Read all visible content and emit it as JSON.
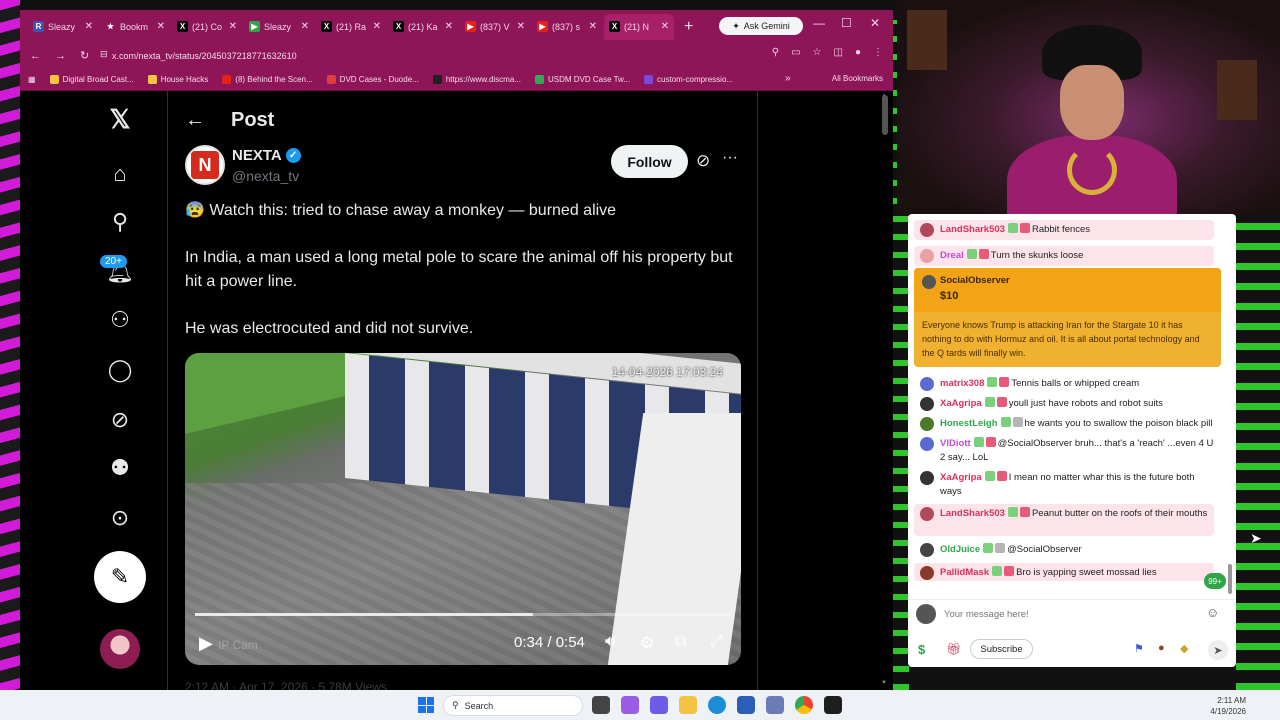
{
  "browser": {
    "tabs": [
      {
        "label": "Sleazy",
        "icon": "R",
        "color": "#3f51b5"
      },
      {
        "label": "Bookm",
        "icon": "★",
        "color": "#8e1558"
      },
      {
        "label": "(21) Co",
        "icon": "X",
        "color": "#000000"
      },
      {
        "label": "Sleazy",
        "icon": "▶",
        "color": "#2fa54a"
      },
      {
        "label": "(21) Ra",
        "icon": "X",
        "color": "#000000"
      },
      {
        "label": "(21) Ka",
        "icon": "X",
        "color": "#000000"
      },
      {
        "label": "(837) V",
        "icon": "▶",
        "color": "#e62117"
      },
      {
        "label": "(837) s",
        "icon": "▶",
        "color": "#e62117"
      },
      {
        "label": "(21) N",
        "icon": "X",
        "color": "#000000"
      }
    ],
    "ask_gemini": "Ask Gemini",
    "url": "x.com/nexta_tv/status/2045037218771632610",
    "bookmarks": [
      {
        "label": "Digital Broad Cast...",
        "color": "#f3c343"
      },
      {
        "label": "House Hacks",
        "color": "#f3c343"
      },
      {
        "label": "(8) Behind the Scen...",
        "color": "#e62117"
      },
      {
        "label": "DVD Cases - Duode...",
        "color": "#e23c3c"
      },
      {
        "label": "https://www.discma...",
        "color": "#222222"
      },
      {
        "label": "USDM DVD Case Tw...",
        "color": "#34a853"
      },
      {
        "label": "custom-compressio...",
        "color": "#7a4bd6"
      }
    ],
    "all_bookmarks": "All Bookmarks"
  },
  "x": {
    "notif_count": "20+",
    "page_title": "Post",
    "author": {
      "name": "NEXTA",
      "handle": "@nexta_tv"
    },
    "follow_label": "Follow",
    "post": {
      "line1": "😰 Watch this: tried to chase away a monkey — burned alive",
      "line2": "In India, a man used a long metal pole to scare the animal off his property but hit a power line.",
      "line3": "He was electrocuted and did not survive."
    },
    "video": {
      "timestamp": "14-04-2026 17:03:24",
      "cam_label": "IP Cam",
      "time": "0:34 / 0:54",
      "progress": 0.63
    },
    "meta": "2:12 AM · Apr 17, 2026 · 5.78M Views"
  },
  "chat": {
    "messages": [
      {
        "user": "LandShark503",
        "text": "Rabbit fences",
        "color": "#d8315b",
        "avatar": "#b04a5a",
        "hl": true
      },
      {
        "user": "Dreal",
        "text": "Turn the skunks loose",
        "color": "#c24ad8",
        "avatar": "#e8a0a0",
        "hl": true
      },
      {
        "user": "matrix308",
        "text": "Tennis balls or whipped cream",
        "color": "#d8315b",
        "avatar": "#5b6ad0",
        "hl": false
      },
      {
        "user": "XaAgripa",
        "text": "youll just have robots and robot suits",
        "color": "#d8315b",
        "avatar": "#333333",
        "hl": false
      },
      {
        "user": "HonestLeigh",
        "text": "he wants you to swallow the poison black pill",
        "color": "#2fa54a",
        "avatar": "#4a7a2a",
        "hl": false
      },
      {
        "user": "VlDiott",
        "text": "@SocialObserver bruh... that's a 'reach' ...even 4 U 2 say... LoL",
        "color": "#c24ad8",
        "avatar": "#5b6ad0",
        "hl": false
      },
      {
        "user": "XaAgripa",
        "text": "I mean no matter whar this is the future both ways",
        "color": "#d8315b",
        "avatar": "#333333",
        "hl": false
      },
      {
        "user": "LandShark503",
        "text": "Peanut butter on the roofs of their mouths",
        "color": "#d8315b",
        "avatar": "#b04a5a",
        "hl": true
      },
      {
        "user": "OldJuice",
        "text": "@SocialObserver",
        "color": "#2fa54a",
        "avatar": "#444444",
        "hl": false
      },
      {
        "user": "PallidMask",
        "text": "Bro is yapping sweet mossad lies",
        "color": "#d8315b",
        "avatar": "#8a3a2a",
        "hl": true
      }
    ],
    "superchat": {
      "user": "SocialObserver",
      "amount": "$10",
      "text": "Everyone knows Trump is attacking Iran for the Stargate 10 it has nothing to do with Hormuz and oil. It is all about portal technology and the Q tards will finally win."
    },
    "new_count": "99+",
    "input_placeholder": "Your message here!",
    "subscribe_label": "Subscribe"
  },
  "taskbar": {
    "search_label": "Search",
    "time": "2:11 AM",
    "date": "4/19/2026"
  }
}
